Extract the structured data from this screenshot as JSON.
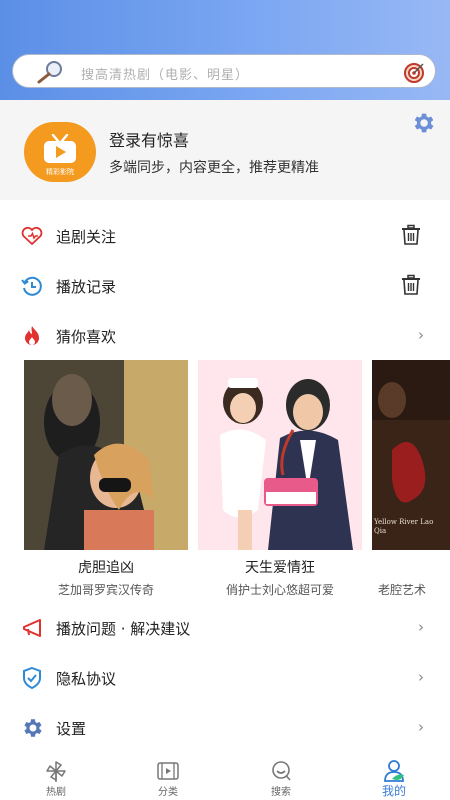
{
  "search": {
    "placeholder": "搜高清热剧（电影、明星）",
    "icon": "magnifier-icon",
    "right_icon": "target-icon"
  },
  "profile": {
    "logo_text": "精彩影院",
    "title": "登录有惊喜",
    "subtitle": "多端同步，内容更全，推荐更精准",
    "settings_icon": "gear-icon"
  },
  "menu": [
    {
      "label": "追剧关注",
      "icon": "heart-icon",
      "action": "trash"
    },
    {
      "label": "播放记录",
      "icon": "history-icon",
      "action": "trash"
    },
    {
      "label": "猜你喜欢",
      "icon": "flame-icon",
      "action": "chevron"
    }
  ],
  "recommendations": [
    {
      "title": "虎胆追凶",
      "subtitle": "芝加哥罗宾汉传奇"
    },
    {
      "title": "天生爱情狂",
      "subtitle": "俏护士刘心悠超可爱"
    },
    {
      "title": "",
      "subtitle": "老腔艺术",
      "poster_text": "Yellow River Lao Qia"
    }
  ],
  "menu2": [
    {
      "label": "播放问题 · 解决建议",
      "icon": "megaphone-icon"
    },
    {
      "label": "隐私协议",
      "icon": "shield-icon"
    },
    {
      "label": "设置",
      "icon": "gear-icon"
    }
  ],
  "chevron": "›",
  "tabs": [
    {
      "label": "热剧",
      "icon": "pinwheel-icon",
      "active": false
    },
    {
      "label": "分类",
      "icon": "film-icon",
      "active": false
    },
    {
      "label": "搜索",
      "icon": "search-icon",
      "active": false
    },
    {
      "label": "我的",
      "icon": "profile-icon",
      "active": true
    }
  ],
  "colors": {
    "header_start": "#5b8fe6",
    "header_end": "#98b8f4",
    "accent": "#3a7bd5",
    "red": "#e0332f",
    "logo": "#f39a1f"
  }
}
